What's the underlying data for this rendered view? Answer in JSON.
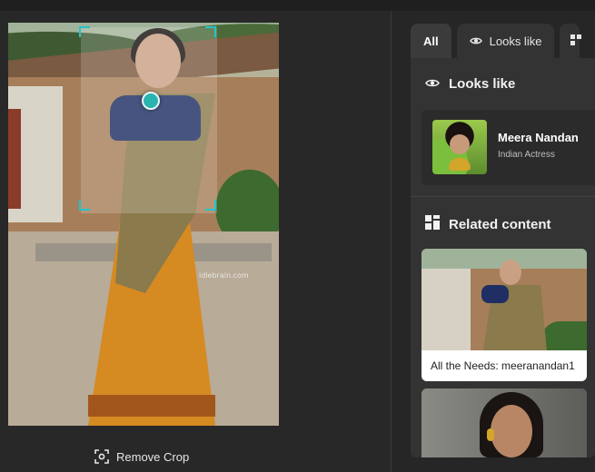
{
  "image_pane": {
    "watermark": "idlebrain.com",
    "remove_crop_label": "Remove Crop",
    "remove_crop_icon": "crop-remove-icon"
  },
  "tabs": [
    {
      "label": "All",
      "active": true
    },
    {
      "label": "Looks like",
      "icon": "eye-icon",
      "active": false
    },
    {
      "label": "",
      "icon": "grid-icon",
      "active": false
    }
  ],
  "looks_like": {
    "title": "Looks like",
    "icon": "eye-icon",
    "person": {
      "name": "Meera Nandan",
      "role": "Indian Actress"
    }
  },
  "related": {
    "title": "Related content",
    "icon": "grid-icon",
    "items": [
      {
        "caption": "All the Needs: meeranandan1"
      },
      {
        "caption": ""
      }
    ]
  },
  "colors": {
    "background": "#262626",
    "panel": "#333333",
    "accent_crop": "#26c2c9",
    "hotspot": "#2bb3b0"
  }
}
